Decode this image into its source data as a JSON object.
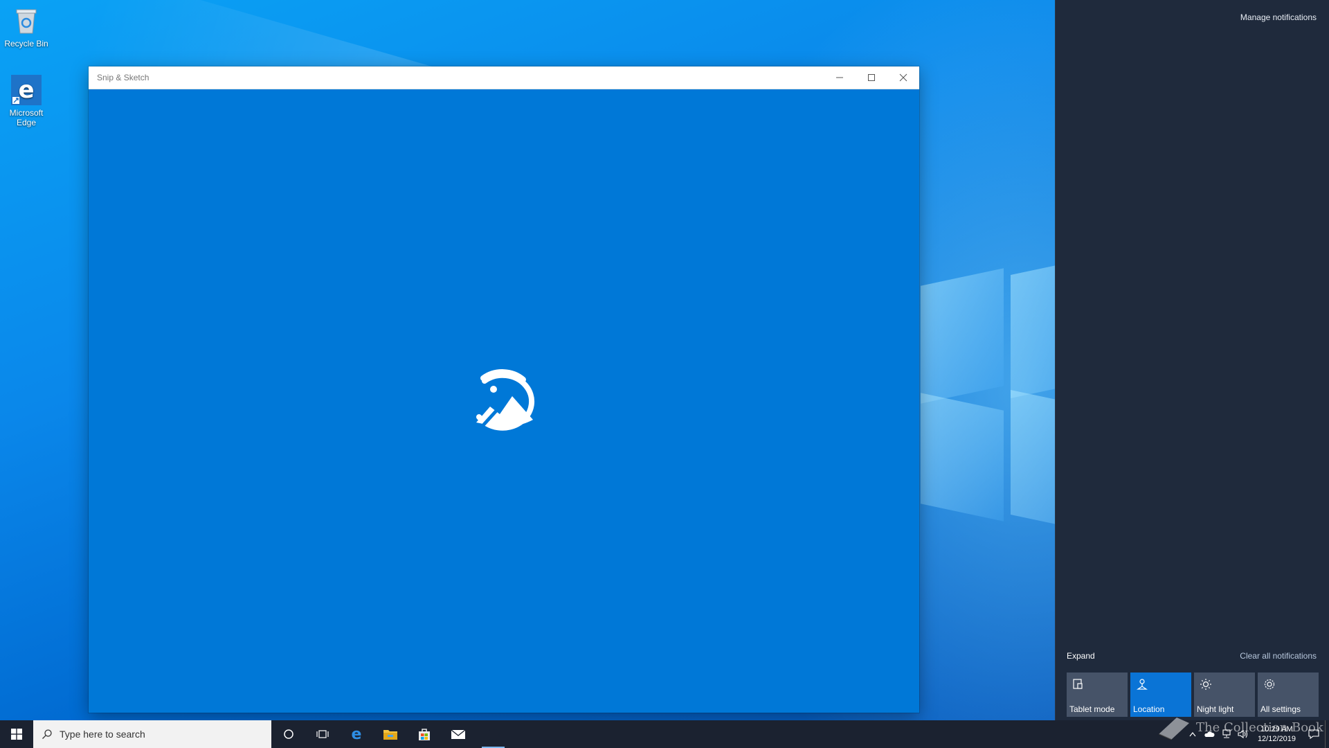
{
  "desktop": {
    "icons": [
      {
        "label": "Recycle Bin",
        "icon": "recycle-bin-icon"
      },
      {
        "label": "Microsoft Edge",
        "icon": "edge-icon"
      }
    ]
  },
  "window": {
    "title": "Snip & Sketch",
    "splash_icon": "snip-sketch-logo-icon",
    "bg_color": "#0078d7"
  },
  "action_center": {
    "manage_notifications": "Manage notifications",
    "expand": "Expand",
    "clear_all": "Clear all notifications",
    "tiles": [
      {
        "label": "Tablet mode",
        "icon": "tablet-mode-icon",
        "active": false
      },
      {
        "label": "Location",
        "icon": "location-icon",
        "active": true
      },
      {
        "label": "Night light",
        "icon": "night-light-icon",
        "active": false
      },
      {
        "label": "All settings",
        "icon": "gear-icon",
        "active": false
      }
    ]
  },
  "taskbar": {
    "search_placeholder": "Type here to search",
    "time": "10:29 AM",
    "date": "12/12/2019"
  },
  "watermark": "The Collection Book"
}
